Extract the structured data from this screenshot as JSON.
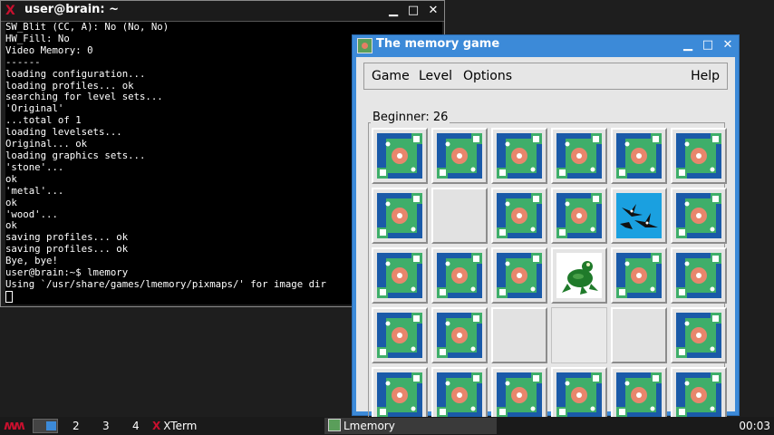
{
  "xterm": {
    "title": "user@brain: ~",
    "lines": [
      "SW_Blit (CC, A): No (No, No)",
      "HW_Fill: No",
      "Video Memory: 0",
      "------",
      "loading configuration...",
      "loading profiles... ok",
      "searching for level sets...",
      "'Original'",
      "...total of 1",
      "loading levelsets...",
      "Original... ok",
      "loading graphics sets...",
      "'stone'...",
      "ok",
      "'metal'...",
      "ok",
      "'wood'...",
      "ok",
      "saving profiles... ok",
      "saving profiles... ok",
      "Bye, bye!",
      "user@brain:~$ lmemory",
      "Using `/usr/share/games/lmemory/pixmaps/' for image dir"
    ]
  },
  "memory": {
    "title": "The memory game",
    "menu": {
      "game": "Game",
      "level": "Level",
      "options": "Options",
      "help": "Help"
    },
    "level_label": "Beginner:",
    "level_count": "26",
    "board": [
      [
        "back",
        "back",
        "back",
        "back",
        "back",
        "back"
      ],
      [
        "back",
        "empty",
        "back",
        "back",
        "birds",
        "back"
      ],
      [
        "back",
        "back",
        "back",
        "frog",
        "back",
        "back"
      ],
      [
        "back",
        "back",
        "empty",
        "flat",
        "empty",
        "back"
      ],
      [
        "back",
        "back",
        "back",
        "back",
        "back",
        "back"
      ]
    ],
    "colors": {
      "card_blue": "#1a5aa8",
      "card_green": "#3fae6a",
      "card_salmon": "#e8866c",
      "birds_sky": "#1aa0e0",
      "frog": "#1f7a2a"
    }
  },
  "taskbar": {
    "desktops": [
      "2",
      "3",
      "4"
    ],
    "tasks": {
      "xterm": "XTerm",
      "lmemory": "Lmemory"
    },
    "clock": "00:03"
  }
}
